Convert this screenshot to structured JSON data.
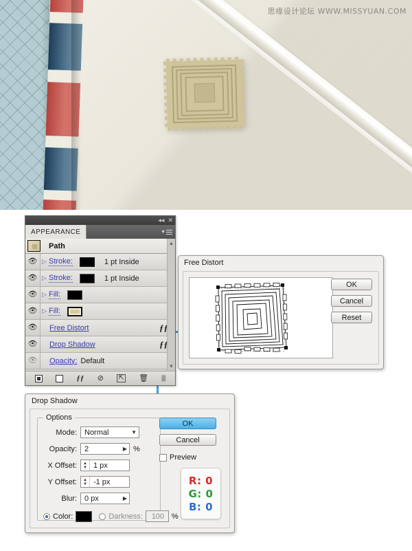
{
  "watermark": "思缘设计论坛  WWW.MISSYUAN.COM",
  "artwork": {
    "name": "stamp-illustration",
    "colors": {
      "paper": "#eceae0",
      "hatch": "#b5cdd2",
      "stripe_red": "#cf6a62",
      "stripe_blue": "#5a7d96",
      "stamp_fill": "#cfc49a"
    }
  },
  "appearance_panel": {
    "tab_label": "APPEARANCE",
    "titlebar": {
      "collapse_icon": "collapse-icon",
      "close_icon": "close-icon",
      "menu_icon": "panel-menu-icon"
    },
    "target_label": "Path",
    "rows": [
      {
        "label": "Stroke:",
        "swatch": "black-framed",
        "meta": "1 pt  Inside",
        "eye": true,
        "disclosure": true,
        "fx": false
      },
      {
        "label": "Stroke:",
        "swatch": "black",
        "meta": "1 pt  Inside",
        "eye": true,
        "disclosure": true,
        "fx": false
      },
      {
        "label": "Fill:",
        "swatch": "black",
        "meta": "",
        "eye": true,
        "disclosure": true,
        "fx": false
      },
      {
        "label": "Fill:",
        "swatch": "tan",
        "meta": "",
        "eye": true,
        "disclosure": true,
        "fx": false
      },
      {
        "label": "Free Distort",
        "swatch": "none",
        "meta": "",
        "eye": true,
        "disclosure": false,
        "fx": true
      },
      {
        "label": "Drop Shadow",
        "swatch": "none",
        "meta": "",
        "eye": true,
        "disclosure": false,
        "fx": true
      },
      {
        "label": "Opacity:",
        "swatch": "none",
        "meta": "Default",
        "eye": true,
        "disclosure": false,
        "fx": false
      }
    ],
    "footer_icons": [
      "add-new-stroke-icon",
      "add-new-fill-icon",
      "add-new-effect-icon",
      "clear-appearance-icon",
      "duplicate-item-icon",
      "delete-item-icon",
      "resize-grip-icon"
    ]
  },
  "free_distort_dialog": {
    "title": "Free Distort",
    "buttons": [
      "OK",
      "Cancel",
      "Reset"
    ],
    "preview_name": "free-distort-preview"
  },
  "drop_shadow_dialog": {
    "title": "Drop Shadow",
    "options_legend": "Options",
    "fields": {
      "mode_label": "Mode:",
      "mode_value": "Normal",
      "opacity_label": "Opacity:",
      "opacity_value": "2",
      "opacity_unit": "%",
      "x_offset_label": "X Offset:",
      "x_offset_value": "1 px",
      "y_offset_label": "Y Offset:",
      "y_offset_value": "-1 px",
      "blur_label": "Blur:",
      "blur_value": "0 px",
      "color_label": "Color:",
      "color_value": "#000000",
      "darkness_label": "Darkness:",
      "darkness_value": "100",
      "darkness_unit": "%"
    },
    "buttons": {
      "ok": "OK",
      "cancel": "Cancel"
    },
    "preview_label": "Preview",
    "rgb_readout": {
      "r": "R: 0",
      "g": "G: 0",
      "b": "B: 0"
    }
  }
}
